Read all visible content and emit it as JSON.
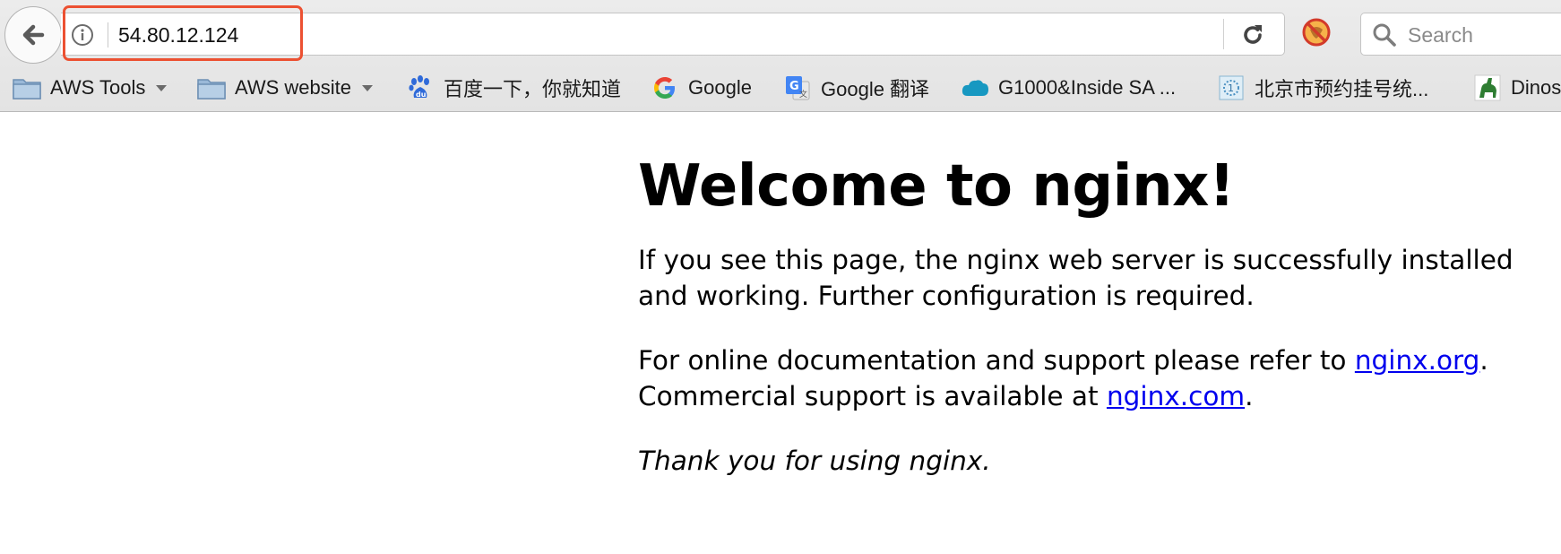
{
  "browser": {
    "url": "54.80.12.124",
    "search_placeholder": "Search",
    "highlight_color": "#ec5132"
  },
  "bookmarks": [
    {
      "label": "AWS Tools",
      "icon": "folder-icon",
      "dropdown": true
    },
    {
      "label": "AWS website",
      "icon": "folder-icon",
      "dropdown": true
    },
    {
      "label": "百度一下，你就知道",
      "icon": "baidu-icon"
    },
    {
      "label": "Google",
      "icon": "google-icon"
    },
    {
      "label": "Google 翻译",
      "icon": "google-translate-icon"
    },
    {
      "label": "G1000&Inside SA ...",
      "icon": "salesforce-icon"
    },
    {
      "label": "北京市预约挂号统...",
      "icon": "hospital-icon"
    },
    {
      "label": "Dinos",
      "icon": "dinosaur-icon"
    }
  ],
  "page": {
    "heading": "Welcome to nginx!",
    "p1": "If you see this page, the nginx web server is successfully installed and working. Further configuration is required.",
    "p2_pre": "For online documentation and support please refer to ",
    "p2_link1": "nginx.org",
    "p2_mid": ".",
    "p2_line2": "Commercial support is available at ",
    "p2_link2": "nginx.com",
    "p2_end": ".",
    "p3": "Thank you for using nginx.",
    "link_color": "#0000ee"
  }
}
